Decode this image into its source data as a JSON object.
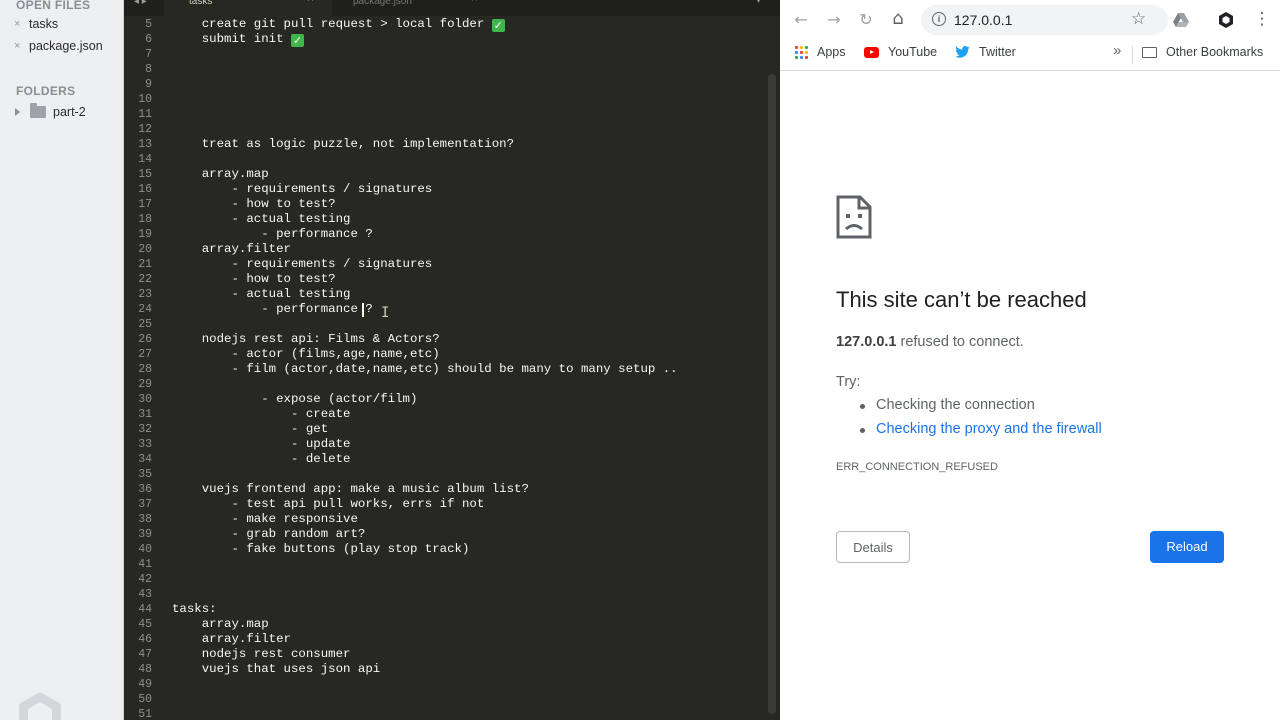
{
  "sidebar": {
    "open_files_header": "OPEN FILES",
    "open_files": [
      {
        "close": "×",
        "name": "tasks"
      },
      {
        "close": "×",
        "name": "package.json"
      }
    ],
    "folders_header": "FOLDERS",
    "folders": [
      {
        "name": "part-2"
      }
    ]
  },
  "editor": {
    "nav_arrows": "◂ ▸",
    "tabs": [
      {
        "label": "tasks",
        "close": "×",
        "active": true
      },
      {
        "label": "package.json",
        "close": "×",
        "active": false
      }
    ],
    "dropdown": "▾",
    "check_glyph": "✓",
    "lines": [
      {
        "n": "5",
        "text": "    create git pull request > local folder ",
        "check": true
      },
      {
        "n": "6",
        "text": "    submit init ",
        "check": true
      },
      {
        "n": "7",
        "text": ""
      },
      {
        "n": "8",
        "text": ""
      },
      {
        "n": "9",
        "text": ""
      },
      {
        "n": "10",
        "text": ""
      },
      {
        "n": "11",
        "text": ""
      },
      {
        "n": "12",
        "text": ""
      },
      {
        "n": "13",
        "text": "    treat as logic puzzle, not implementation?"
      },
      {
        "n": "14",
        "text": ""
      },
      {
        "n": "15",
        "text": "    array.map"
      },
      {
        "n": "16",
        "text": "        - requirements / signatures"
      },
      {
        "n": "17",
        "text": "        - how to test?"
      },
      {
        "n": "18",
        "text": "        - actual testing"
      },
      {
        "n": "19",
        "text": "            - performance ?"
      },
      {
        "n": "20",
        "text": "    array.filter"
      },
      {
        "n": "21",
        "text": "        - requirements / signatures"
      },
      {
        "n": "22",
        "text": "        - how to test?"
      },
      {
        "n": "23",
        "text": "        - actual testing"
      },
      {
        "n": "24",
        "text": "            - performance ?"
      },
      {
        "n": "25",
        "text": ""
      },
      {
        "n": "26",
        "text": "    nodejs rest api: Films & Actors?"
      },
      {
        "n": "27",
        "text": "        - actor (films,age,name,etc)"
      },
      {
        "n": "28",
        "text": "        - film (actor,date,name,etc) should be many to many setup .."
      },
      {
        "n": "29",
        "text": ""
      },
      {
        "n": "30",
        "text": "            - expose (actor/film)"
      },
      {
        "n": "31",
        "text": "                - create"
      },
      {
        "n": "32",
        "text": "                - get"
      },
      {
        "n": "33",
        "text": "                - update"
      },
      {
        "n": "34",
        "text": "                - delete"
      },
      {
        "n": "35",
        "text": ""
      },
      {
        "n": "36",
        "text": "    vuejs frontend app: make a music album list?"
      },
      {
        "n": "37",
        "text": "        - test api pull works, errs if not"
      },
      {
        "n": "38",
        "text": "        - make responsive"
      },
      {
        "n": "39",
        "text": "        - grab random art?"
      },
      {
        "n": "40",
        "text": "        - fake buttons (play stop track)"
      },
      {
        "n": "41",
        "text": ""
      },
      {
        "n": "42",
        "text": ""
      },
      {
        "n": "43",
        "text": ""
      },
      {
        "n": "44",
        "text": "tasks:"
      },
      {
        "n": "45",
        "text": "    array.map"
      },
      {
        "n": "46",
        "text": "    array.filter"
      },
      {
        "n": "47",
        "text": "    nodejs rest consumer"
      },
      {
        "n": "48",
        "text": "    vuejs that uses json api"
      },
      {
        "n": "49",
        "text": ""
      },
      {
        "n": "50",
        "text": ""
      },
      {
        "n": "51",
        "text": ""
      }
    ]
  },
  "browser": {
    "back_icon": "←",
    "forward_icon": "→",
    "reload_icon": "↻",
    "home_icon": "⌂",
    "star_icon": "☆",
    "url": "127.0.0.1",
    "info_icon": "i",
    "bookmarks": {
      "apps": "Apps",
      "youtube": "YouTube",
      "twitter": "Twitter",
      "more": "»",
      "other": "Other Bookmarks"
    },
    "colors": {
      "apps_dots": [
        "#ea4335",
        "#fbbc04",
        "#34a853",
        "#4285f4",
        "#ea4335",
        "#fbbc04",
        "#34a853",
        "#4285f4",
        "#ea4335"
      ]
    },
    "error": {
      "title": "This site can’t be reached",
      "host": "127.0.0.1",
      "host_suffix": " refused to connect.",
      "try_label": "Try:",
      "suggestions": [
        "Checking the connection",
        "Checking the proxy and the firewall"
      ],
      "code": "ERR_CONNECTION_REFUSED",
      "details_button": "Details",
      "reload_button": "Reload"
    }
  }
}
